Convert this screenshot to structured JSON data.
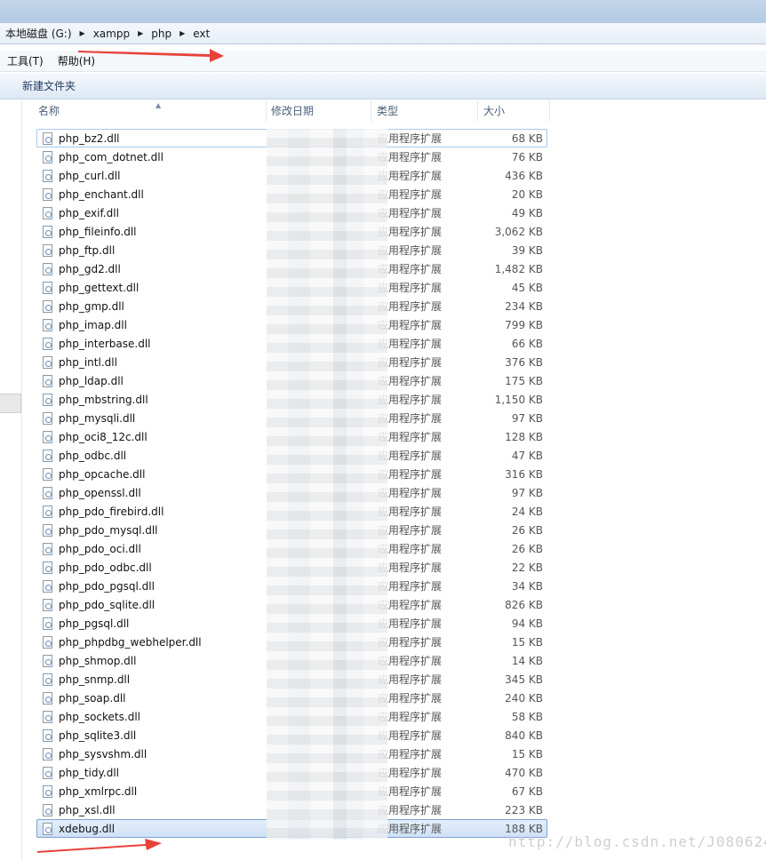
{
  "breadcrumb": [
    "本地磁盘 (G:)",
    "xampp",
    "php",
    "ext"
  ],
  "menu": {
    "tools": "工具(T)",
    "help": "帮助(H)"
  },
  "commands": {
    "new_folder": "新建文件夹"
  },
  "columns": {
    "name": "名称",
    "date": "修改日期",
    "type": "类型",
    "size": "大小"
  },
  "files": [
    {
      "name": "php_bz2.dll",
      "type": "应用程序扩展",
      "size": "68 KB"
    },
    {
      "name": "php_com_dotnet.dll",
      "type": "应用程序扩展",
      "size": "76 KB"
    },
    {
      "name": "php_curl.dll",
      "type": "应用程序扩展",
      "size": "436 KB"
    },
    {
      "name": "php_enchant.dll",
      "type": "应用程序扩展",
      "size": "20 KB"
    },
    {
      "name": "php_exif.dll",
      "type": "应用程序扩展",
      "size": "49 KB"
    },
    {
      "name": "php_fileinfo.dll",
      "type": "应用程序扩展",
      "size": "3,062 KB"
    },
    {
      "name": "php_ftp.dll",
      "type": "应用程序扩展",
      "size": "39 KB"
    },
    {
      "name": "php_gd2.dll",
      "type": "应用程序扩展",
      "size": "1,482 KB"
    },
    {
      "name": "php_gettext.dll",
      "type": "应用程序扩展",
      "size": "45 KB"
    },
    {
      "name": "php_gmp.dll",
      "type": "应用程序扩展",
      "size": "234 KB"
    },
    {
      "name": "php_imap.dll",
      "type": "应用程序扩展",
      "size": "799 KB"
    },
    {
      "name": "php_interbase.dll",
      "type": "应用程序扩展",
      "size": "66 KB"
    },
    {
      "name": "php_intl.dll",
      "type": "应用程序扩展",
      "size": "376 KB"
    },
    {
      "name": "php_ldap.dll",
      "type": "应用程序扩展",
      "size": "175 KB"
    },
    {
      "name": "php_mbstring.dll",
      "type": "应用程序扩展",
      "size": "1,150 KB"
    },
    {
      "name": "php_mysqli.dll",
      "type": "应用程序扩展",
      "size": "97 KB"
    },
    {
      "name": "php_oci8_12c.dll",
      "type": "应用程序扩展",
      "size": "128 KB"
    },
    {
      "name": "php_odbc.dll",
      "type": "应用程序扩展",
      "size": "47 KB"
    },
    {
      "name": "php_opcache.dll",
      "type": "应用程序扩展",
      "size": "316 KB"
    },
    {
      "name": "php_openssl.dll",
      "type": "应用程序扩展",
      "size": "97 KB"
    },
    {
      "name": "php_pdo_firebird.dll",
      "type": "应用程序扩展",
      "size": "24 KB"
    },
    {
      "name": "php_pdo_mysql.dll",
      "type": "应用程序扩展",
      "size": "26 KB"
    },
    {
      "name": "php_pdo_oci.dll",
      "type": "应用程序扩展",
      "size": "26 KB"
    },
    {
      "name": "php_pdo_odbc.dll",
      "type": "应用程序扩展",
      "size": "22 KB"
    },
    {
      "name": "php_pdo_pgsql.dll",
      "type": "应用程序扩展",
      "size": "34 KB"
    },
    {
      "name": "php_pdo_sqlite.dll",
      "type": "应用程序扩展",
      "size": "826 KB"
    },
    {
      "name": "php_pgsql.dll",
      "type": "应用程序扩展",
      "size": "94 KB"
    },
    {
      "name": "php_phpdbg_webhelper.dll",
      "type": "应用程序扩展",
      "size": "15 KB"
    },
    {
      "name": "php_shmop.dll",
      "type": "应用程序扩展",
      "size": "14 KB"
    },
    {
      "name": "php_snmp.dll",
      "type": "应用程序扩展",
      "size": "345 KB"
    },
    {
      "name": "php_soap.dll",
      "type": "应用程序扩展",
      "size": "240 KB"
    },
    {
      "name": "php_sockets.dll",
      "type": "应用程序扩展",
      "size": "58 KB"
    },
    {
      "name": "php_sqlite3.dll",
      "type": "应用程序扩展",
      "size": "840 KB"
    },
    {
      "name": "php_sysvshm.dll",
      "type": "应用程序扩展",
      "size": "15 KB"
    },
    {
      "name": "php_tidy.dll",
      "type": "应用程序扩展",
      "size": "470 KB"
    },
    {
      "name": "php_xmlrpc.dll",
      "type": "应用程序扩展",
      "size": "67 KB"
    },
    {
      "name": "php_xsl.dll",
      "type": "应用程序扩展",
      "size": "223 KB"
    },
    {
      "name": "xdebug.dll",
      "type": "应用程序扩展",
      "size": "188 KB"
    }
  ],
  "watermark": "http://blog.csdn.net/J080624",
  "colors": {
    "arrow": "#e8413a",
    "selection": "#cfe1f6"
  }
}
